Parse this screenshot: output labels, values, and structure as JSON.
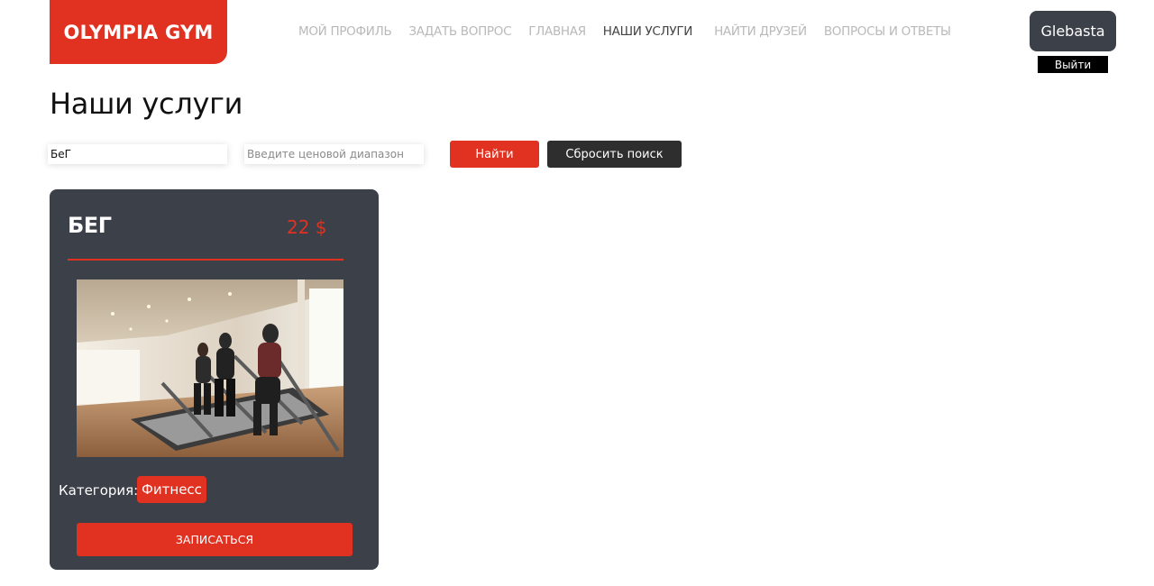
{
  "header": {
    "logo": "OLYMPIA GYM",
    "nav": [
      {
        "label": "МОЙ ПРОФИЛЬ",
        "active": false
      },
      {
        "label": "ЗАДАТЬ ВОПРОС",
        "active": false
      },
      {
        "label": "ГЛАВНАЯ",
        "active": false
      },
      {
        "label": "НАШИ УСЛУГИ",
        "active": true
      },
      {
        "label": "НАЙТИ ДРУЗЕЙ",
        "active": false
      },
      {
        "label": "ВОПРОСЫ И ОТВЕТЫ",
        "active": false
      }
    ],
    "username": "Glebasta",
    "logout_label": "Выйти"
  },
  "page_title": "Наши услуги",
  "search": {
    "name_value": "БеГ",
    "price_placeholder": "Введите ценовой диапазон",
    "find_label": "Найти",
    "reset_label": "Сбросить поиск"
  },
  "services": [
    {
      "title": "БЕГ",
      "price": "22 $",
      "image_icon": "treadmill-running-photo",
      "category_label": "Категория:",
      "category": "Фитнесс",
      "enroll_label": "ЗАПИСАТЬСЯ"
    }
  ],
  "colors": {
    "accent": "#e03121",
    "card_bg": "#3c4049",
    "dark_button": "#2e2e2e"
  }
}
